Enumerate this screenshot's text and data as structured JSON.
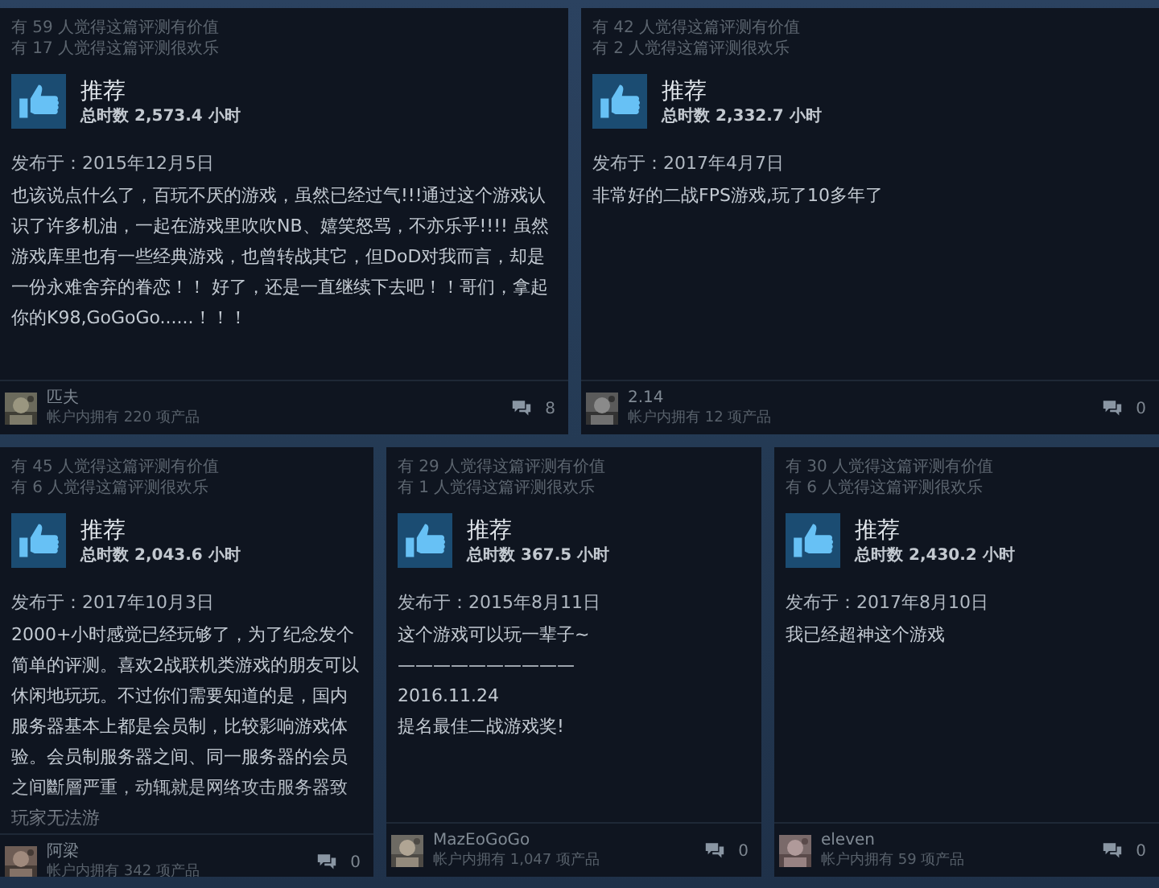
{
  "review_rows": [
    {
      "reviews": [
        {
          "helpful": "有 59 人觉得这篇评测有价值",
          "funny": "有 17 人觉得这篇评测很欢乐",
          "verdict": "推荐",
          "recommended": true,
          "hours": "总时数 2,573.4 小时",
          "posted": "发布于：2015年12月5日",
          "body": [
            "也该说点什么了，百玩不厌的游戏，虽然已经过气!!!通过这个游戏认识了许多机油，一起在游戏里吹吹NB、嬉笑怒骂，不亦乐乎!!!! 虽然游戏库里也有一些经典游戏，也曾转战其它，但DoD对我而言，却是一份永难舍弃的眷恋！！ 好了，还是一直继续下去吧！！哥们，拿起你的K98,GoGoGo......！！！"
          ],
          "truncated": false,
          "author": "匹夫",
          "products": "帐户内拥有 220 项产品",
          "comments": "8"
        },
        {
          "helpful": "有 42 人觉得这篇评测有价值",
          "funny": "有 2 人觉得这篇评测很欢乐",
          "verdict": "推荐",
          "recommended": true,
          "hours": "总时数 2,332.7 小时",
          "posted": "发布于：2017年4月7日",
          "body": [
            "非常好的二战FPS游戏,玩了10多年了"
          ],
          "truncated": false,
          "author": "2.14",
          "products": "帐户内拥有 12 项产品",
          "comments": "0"
        }
      ]
    },
    {
      "reviews": [
        {
          "helpful": "有 45 人觉得这篇评测有价值",
          "funny": "有 6 人觉得这篇评测很欢乐",
          "verdict": "推荐",
          "recommended": true,
          "hours": "总时数 2,043.6 小时",
          "posted": "发布于：2017年10月3日",
          "body": [
            "2000+小时感觉已经玩够了，为了纪念发个简单的评测。喜欢2战联机类游戏的朋友可以休闲地玩玩。不过你们需要知道的是，国内服务器基本上都是会员制，比较影响游戏体验。会员制服务器之间、同一服务器的会员之间斷層严重，动辄就是网络攻击服务器致玩家无法游"
          ],
          "truncated": true,
          "author": "阿梁",
          "products": "帐户内拥有 342 项产品",
          "comments": "0"
        },
        {
          "helpful": "有 29 人觉得这篇评测有价值",
          "funny": "有 1 人觉得这篇评测很欢乐",
          "verdict": "推荐",
          "recommended": true,
          "hours": "总时数 367.5 小时",
          "posted": "发布于：2015年8月11日",
          "body": [
            "这个游戏可以玩一辈子~",
            "——————————",
            "2016.11.24",
            "提名最佳二战游戏奖!"
          ],
          "truncated": false,
          "author": "MazEoGoGo",
          "products": "帐户内拥有 1,047 项产品",
          "comments": "0"
        },
        {
          "helpful": "有 30 人觉得这篇评测有价值",
          "funny": "有 6 人觉得这篇评测很欢乐",
          "verdict": "推荐",
          "recommended": true,
          "hours": "总时数 2,430.2 小时",
          "posted": "发布于：2017年8月10日",
          "body": [
            "我已经超神这个游戏"
          ],
          "truncated": false,
          "author": "eleven",
          "products": "帐户内拥有 59 项产品",
          "comments": "0"
        }
      ]
    }
  ]
}
